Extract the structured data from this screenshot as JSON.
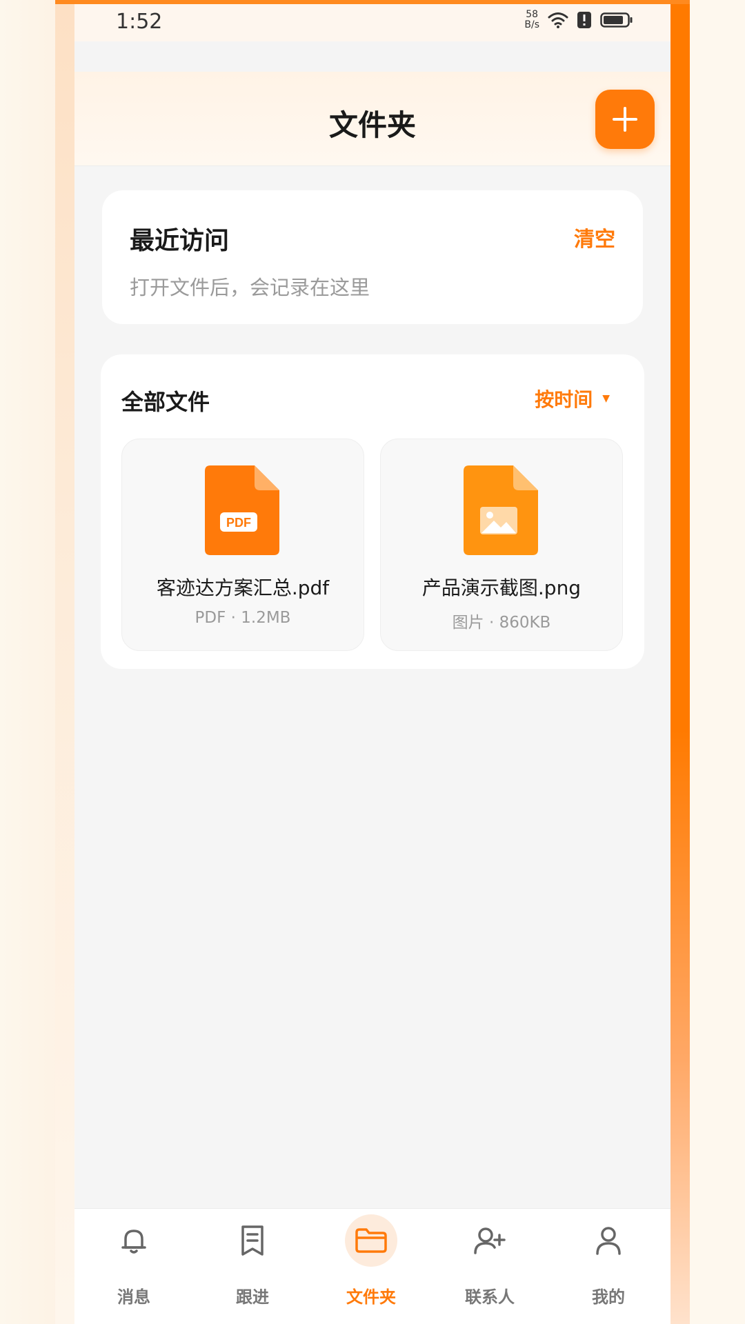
{
  "status_bar": {
    "time": "1:52",
    "net_speed_value": "58",
    "net_speed_unit": "B/s",
    "icons": [
      "wifi-icon",
      "alert-icon",
      "battery-icon"
    ]
  },
  "header": {
    "title": "文件夹",
    "add_icon": "plus-icon"
  },
  "recent": {
    "title": "最近访问",
    "clear_label": "清空",
    "empty_hint": "打开文件后，会记录在这里"
  },
  "files": {
    "title": "全部文件",
    "sort_label": "按时间",
    "sort_icon": "caret-down-icon",
    "items": [
      {
        "name": "客迹达方案汇总.pdf",
        "meta": "PDF · 1.2MB",
        "icon": "pdf-file-icon",
        "badge": "PDF"
      },
      {
        "name": "产品演示截图.png",
        "meta": "图片 · 860KB",
        "icon": "image-file-icon"
      }
    ]
  },
  "nav": {
    "items": [
      {
        "label": "消息",
        "icon": "bell-icon"
      },
      {
        "label": "跟进",
        "icon": "note-icon"
      },
      {
        "label": "文件夹",
        "icon": "folder-icon",
        "active": true
      },
      {
        "label": "联系人",
        "icon": "add-contact-icon"
      },
      {
        "label": "我的",
        "icon": "person-icon"
      }
    ]
  },
  "colors": {
    "accent": "#ff7a0a",
    "background": "#f5f5f5",
    "card": "#ffffff",
    "muted_text": "#9a9a9a"
  }
}
